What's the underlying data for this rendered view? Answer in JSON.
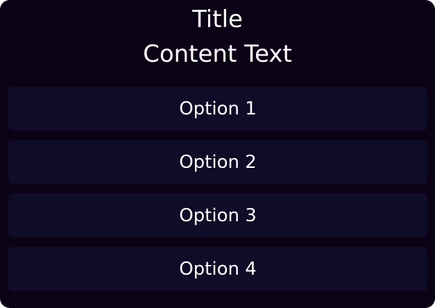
{
  "dialog": {
    "title": "Title",
    "content": "Content Text",
    "options": [
      {
        "label": "Option 1"
      },
      {
        "label": "Option 2"
      },
      {
        "label": "Option 3"
      },
      {
        "label": "Option 4"
      }
    ]
  },
  "colors": {
    "background": "#0c0216",
    "option_background": "#0f0c27",
    "text": "#ffffff"
  }
}
